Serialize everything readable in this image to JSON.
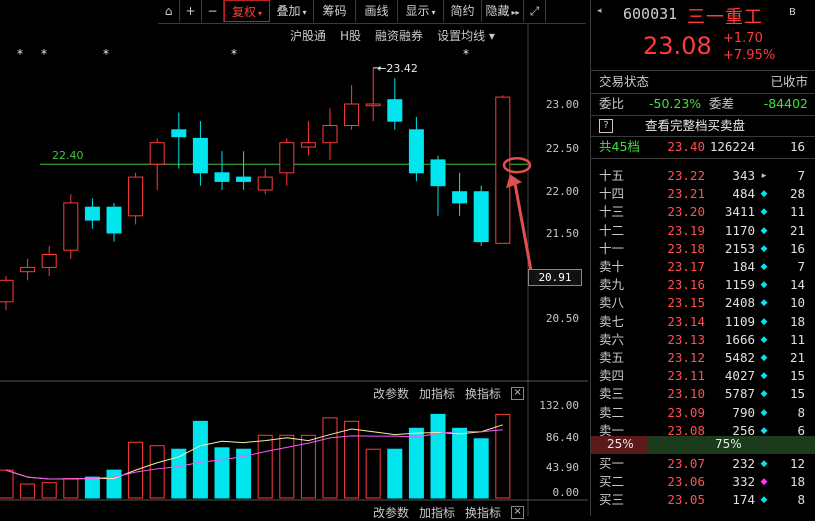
{
  "toolbar": {
    "items": [
      {
        "label": "",
        "icon": "lock-icon"
      },
      {
        "label": "+"
      },
      {
        "label": "−"
      },
      {
        "label": "复权",
        "caret": "▾",
        "active": true
      },
      {
        "label": "叠加",
        "caret": "▾"
      },
      {
        "label": "筹码"
      },
      {
        "label": "画线"
      },
      {
        "label": "显示",
        "caret": "▾"
      },
      {
        "label": "简约"
      },
      {
        "label": "隐藏",
        "caret": "▸▸"
      },
      {
        "label": "",
        "icon": "fullscreen-icon"
      }
    ]
  },
  "subbar": [
    "沪股通",
    "H股",
    "融资融券",
    "设置均线 ▾"
  ],
  "chart": {
    "price_axis": [
      "23.00",
      "22.50",
      "22.00",
      "21.50",
      "20.50"
    ],
    "current_price_tag": "20.91",
    "line_label": "22.40",
    "high_label": "←23.42",
    "stars": [
      "*",
      "*",
      "*",
      "*",
      "*"
    ],
    "volume_toolbar": [
      "改参数",
      "加指标",
      "换指标"
    ],
    "volume_axis": [
      "132.00",
      "86.40",
      "43.90",
      "0.00"
    ],
    "bottom_toolbar": [
      "改参数",
      "加指标",
      "换指标"
    ]
  },
  "chart_data": {
    "type": "candlestick",
    "candles": [
      {
        "o": 20.7,
        "c": 20.95,
        "h": 21.0,
        "l": 20.6
      },
      {
        "o": 21.05,
        "c": 21.1,
        "h": 21.2,
        "l": 20.95
      },
      {
        "o": 21.1,
        "c": 21.25,
        "h": 21.35,
        "l": 21.0
      },
      {
        "o": 21.3,
        "c": 21.85,
        "h": 21.95,
        "l": 21.2
      },
      {
        "o": 21.8,
        "c": 21.65,
        "h": 21.9,
        "l": 21.55
      },
      {
        "o": 21.8,
        "c": 21.5,
        "h": 21.85,
        "l": 21.4
      },
      {
        "o": 21.7,
        "c": 22.15,
        "h": 22.2,
        "l": 21.6
      },
      {
        "o": 22.3,
        "c": 22.55,
        "h": 22.6,
        "l": 22.0
      },
      {
        "o": 22.7,
        "c": 22.62,
        "h": 22.9,
        "l": 22.25
      },
      {
        "o": 22.6,
        "c": 22.2,
        "h": 22.8,
        "l": 22.05
      },
      {
        "o": 22.2,
        "c": 22.1,
        "h": 22.45,
        "l": 22.0
      },
      {
        "o": 22.15,
        "c": 22.1,
        "h": 22.45,
        "l": 22.0
      },
      {
        "o": 22.0,
        "c": 22.15,
        "h": 22.25,
        "l": 21.95
      },
      {
        "o": 22.2,
        "c": 22.55,
        "h": 22.6,
        "l": 22.05
      },
      {
        "o": 22.5,
        "c": 22.55,
        "h": 22.8,
        "l": 22.4
      },
      {
        "o": 22.55,
        "c": 22.75,
        "h": 22.95,
        "l": 22.35
      },
      {
        "o": 22.75,
        "c": 23.0,
        "h": 23.22,
        "l": 22.7
      },
      {
        "o": 22.98,
        "c": 23.0,
        "h": 23.42,
        "l": 22.8
      },
      {
        "o": 23.05,
        "c": 22.8,
        "h": 23.3,
        "l": 22.7
      },
      {
        "o": 22.7,
        "c": 22.2,
        "h": 22.85,
        "l": 22.1
      },
      {
        "o": 22.35,
        "c": 22.05,
        "h": 22.4,
        "l": 21.7
      },
      {
        "o": 21.98,
        "c": 21.85,
        "h": 22.2,
        "l": 21.7
      },
      {
        "o": 21.98,
        "c": 21.4,
        "h": 22.05,
        "l": 21.35
      },
      {
        "o": 21.38,
        "c": 23.08,
        "h": 23.1,
        "l": 21.38
      }
    ],
    "volume": [
      40,
      20,
      22,
      28,
      30,
      40,
      80,
      75,
      70,
      110,
      72,
      70,
      90,
      90,
      90,
      115,
      110,
      70,
      70,
      100,
      120,
      100,
      85,
      120
    ]
  },
  "quote": {
    "code": "600031",
    "name": "三一重工",
    "flag": "B",
    "price": "23.08",
    "change": "+1.70",
    "change_pct": "+7.95%",
    "status_label": "交易状态",
    "status_value": "已收市",
    "weibi_label": "委比",
    "weibi_value": "-50.23%",
    "weicha_label": "委差",
    "weicha_value": "-84402",
    "full_book_label": "查看完整档买卖盘",
    "full_book_icon": "?",
    "total_label": "共45档",
    "total_price": "23.40",
    "total_vol": "126224",
    "total_cnt": "16",
    "asks": [
      {
        "label": "十五",
        "price": "23.22",
        "vol": "343",
        "cnt": "7",
        "dot": "▸"
      },
      {
        "label": "十四",
        "price": "23.21",
        "vol": "484",
        "cnt": "28",
        "dot": "◆"
      },
      {
        "label": "十三",
        "price": "23.20",
        "vol": "3411",
        "cnt": "11",
        "dot": "◆"
      },
      {
        "label": "十二",
        "price": "23.19",
        "vol": "1170",
        "cnt": "21",
        "dot": "◆"
      },
      {
        "label": "十一",
        "price": "23.18",
        "vol": "2153",
        "cnt": "16",
        "dot": "◆"
      },
      {
        "label": "卖十",
        "price": "23.17",
        "vol": "184",
        "cnt": "7",
        "dot": "◆"
      },
      {
        "label": "卖九",
        "price": "23.16",
        "vol": "1159",
        "cnt": "14",
        "dot": "◆"
      },
      {
        "label": "卖八",
        "price": "23.15",
        "vol": "2408",
        "cnt": "10",
        "dot": "◆"
      },
      {
        "label": "卖七",
        "price": "23.14",
        "vol": "1109",
        "cnt": "18",
        "dot": "◆"
      },
      {
        "label": "卖六",
        "price": "23.13",
        "vol": "1666",
        "cnt": "11",
        "dot": "◆"
      },
      {
        "label": "卖五",
        "price": "23.12",
        "vol": "5482",
        "cnt": "21",
        "dot": "◆"
      },
      {
        "label": "卖四",
        "price": "23.11",
        "vol": "4027",
        "cnt": "15",
        "dot": "◆"
      },
      {
        "label": "卖三",
        "price": "23.10",
        "vol": "5787",
        "cnt": "15",
        "dot": "◆"
      },
      {
        "label": "卖二",
        "price": "23.09",
        "vol": "790",
        "cnt": "8",
        "dot": "◆"
      },
      {
        "label": "卖一",
        "price": "23.08",
        "vol": "256",
        "cnt": "6",
        "dot": "◆"
      }
    ],
    "ratio_sell": "25%",
    "ratio_buy": "75%",
    "ratio_sell_fraction": 0.25,
    "bids": [
      {
        "label": "买一",
        "price": "23.07",
        "vol": "232",
        "cnt": "12",
        "dot": "◆"
      },
      {
        "label": "买二",
        "price": "23.06",
        "vol": "332",
        "cnt": "18",
        "dot": "◆"
      },
      {
        "label": "买三",
        "price": "23.05",
        "vol": "174",
        "cnt": "8",
        "dot": "◆"
      }
    ]
  },
  "colors": {
    "up": "#ff3b3b",
    "down": "#00e5ee",
    "ma_line": "#3ec43e",
    "annotation": "#e05050",
    "dot_cyan": "#00e5ee",
    "dot_magenta": "#ff33ff"
  }
}
